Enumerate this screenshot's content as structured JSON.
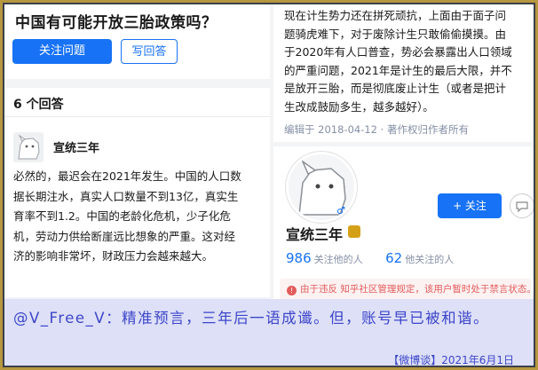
{
  "question": {
    "title": "中国有可能开放三胎政策吗？",
    "follow_button": "关注问题",
    "answer_button": "写回答",
    "answer_count": "6 个回答"
  },
  "answer": {
    "author": "宣统三年",
    "lines": [
      "必然的，最迟会在2021年发生。中国的人口数",
      "据长期注水，真实人口数量不到13亿，真实生",
      "育率不到1.2。中国的老龄化危机，少子化危",
      "机，劳动力供给断崖远比想象的严重。这对经",
      "济的影响非常坏，财政压力会越来越大。"
    ]
  },
  "continuation": {
    "lines": [
      "现在计生势力还在拼死顽抗，上面由于面子问",
      "题骑虎难下，对于废除计生只敢偷偷摸摸。由",
      "于2020年有人口普查，势必会暴露出人口领域",
      "的严重问题，2021年是计生的最后大限，并不",
      "是放开三胎，而是彻底废止计生（或者是把计",
      "生改成鼓励多生，越多越好）。"
    ],
    "edit_info": "编辑于 2018-04-12 · 著作权归作者所有"
  },
  "profile": {
    "name": "宣统三年",
    "follow_button": "+ 关注",
    "gender_symbol": "♂",
    "following_count": "986",
    "following_label": "关注他的人",
    "followers_count": "62",
    "followers_label": "他关注的人",
    "warning_icon": "!",
    "warning_text": "由于违反 知乎社区管理规定，该用户暂时处于禁言状态。"
  },
  "caption": {
    "text": "@V_Free_V：精准预言，三年后一语成谶。但，账号早已被和谐。",
    "source_date": "【微博谈】2021年6月1日"
  },
  "colors": {
    "accent": "#1772f6",
    "caption_text": "#3d45c9",
    "caption_bg": "#dde0f7",
    "border": "#b7973f",
    "warning": "#e35b5b"
  }
}
